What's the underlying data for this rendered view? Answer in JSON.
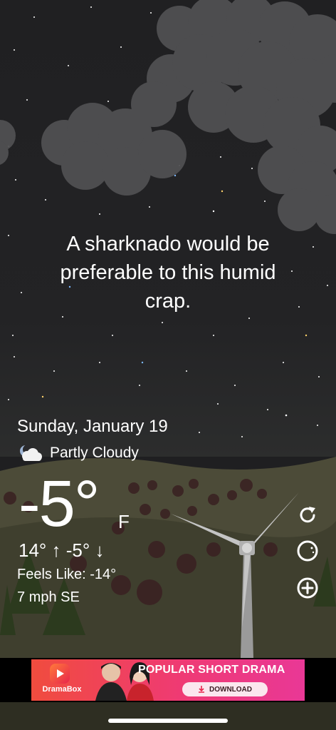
{
  "quote": {
    "line1": "A sharknado would be",
    "line2": "preferable to this humid",
    "line3": "crap."
  },
  "weather": {
    "date": "Sunday, January 19",
    "condition": "Partly Cloudy",
    "condition_icon": "partly-cloudy-night-icon",
    "temperature": "-5°",
    "unit": "F",
    "hi_lo": "14° ↑  -5° ↓",
    "feels_like": "Feels Like: -14°",
    "wind": "7 mph SE"
  },
  "actions": {
    "refresh_icon": "refresh-icon",
    "moon_icon": "moon-icon",
    "add_icon": "add-icon"
  },
  "ad": {
    "brand": "DramaBox",
    "title": "POPULAR SHORT DRAMA",
    "button": "DOWNLOAD"
  },
  "colors": {
    "sky": "#202022",
    "land": "#4a4a33",
    "ad_start": "#f04c3e",
    "ad_end": "#e93896"
  }
}
